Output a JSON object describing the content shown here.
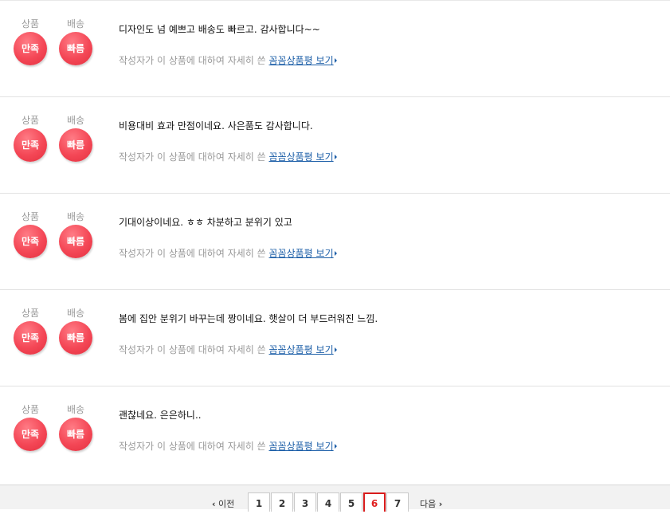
{
  "reviews": [
    {
      "product_label": "상품",
      "product_badge": "만족",
      "delivery_label": "배송",
      "delivery_badge": "빠름",
      "text": "디자인도 넘 예쁘고 배송도 빠르고. 감사합니다~~",
      "meta_text": "작성자가 이 상품에 대하여 자세히 쓴",
      "link_text": "꼼꼼상품평 보기"
    },
    {
      "product_label": "상품",
      "product_badge": "만족",
      "delivery_label": "배송",
      "delivery_badge": "빠름",
      "text": "비용대비 효과 만점이네요. 사은품도 감사합니다.",
      "meta_text": "작성자가 이 상품에 대하여 자세히 쓴",
      "link_text": "꼼꼼상품평 보기"
    },
    {
      "product_label": "상품",
      "product_badge": "만족",
      "delivery_label": "배송",
      "delivery_badge": "빠름",
      "text": "기대이상이네요. ㅎㅎ 차분하고 분위기 있고",
      "meta_text": "작성자가 이 상품에 대하여 자세히 쓴",
      "link_text": "꼼꼼상품평 보기"
    },
    {
      "product_label": "상품",
      "product_badge": "만족",
      "delivery_label": "배송",
      "delivery_badge": "빠름",
      "text": "봄에 집안 분위기 바꾸는데 짱이네요. 햇살이 더 부드러워진 느낌.",
      "meta_text": "작성자가 이 상품에 대하여 자세히 쓴",
      "link_text": "꼼꼼상품평 보기"
    },
    {
      "product_label": "상품",
      "product_badge": "만족",
      "delivery_label": "배송",
      "delivery_badge": "빠름",
      "text": "괜찮네요. 은은하니..",
      "meta_text": "작성자가 이 상품에 대하여 자세히 쓴",
      "link_text": "꼼꼼상품평 보기"
    }
  ],
  "pagination": {
    "prev_label": "이전",
    "next_label": "다음",
    "pages": [
      "1",
      "2",
      "3",
      "4",
      "5",
      "6",
      "7"
    ],
    "current_page": "6"
  },
  "colors": {
    "badge": "#f44756",
    "link": "#1d5fa8",
    "current_page": "#d81c1c"
  }
}
